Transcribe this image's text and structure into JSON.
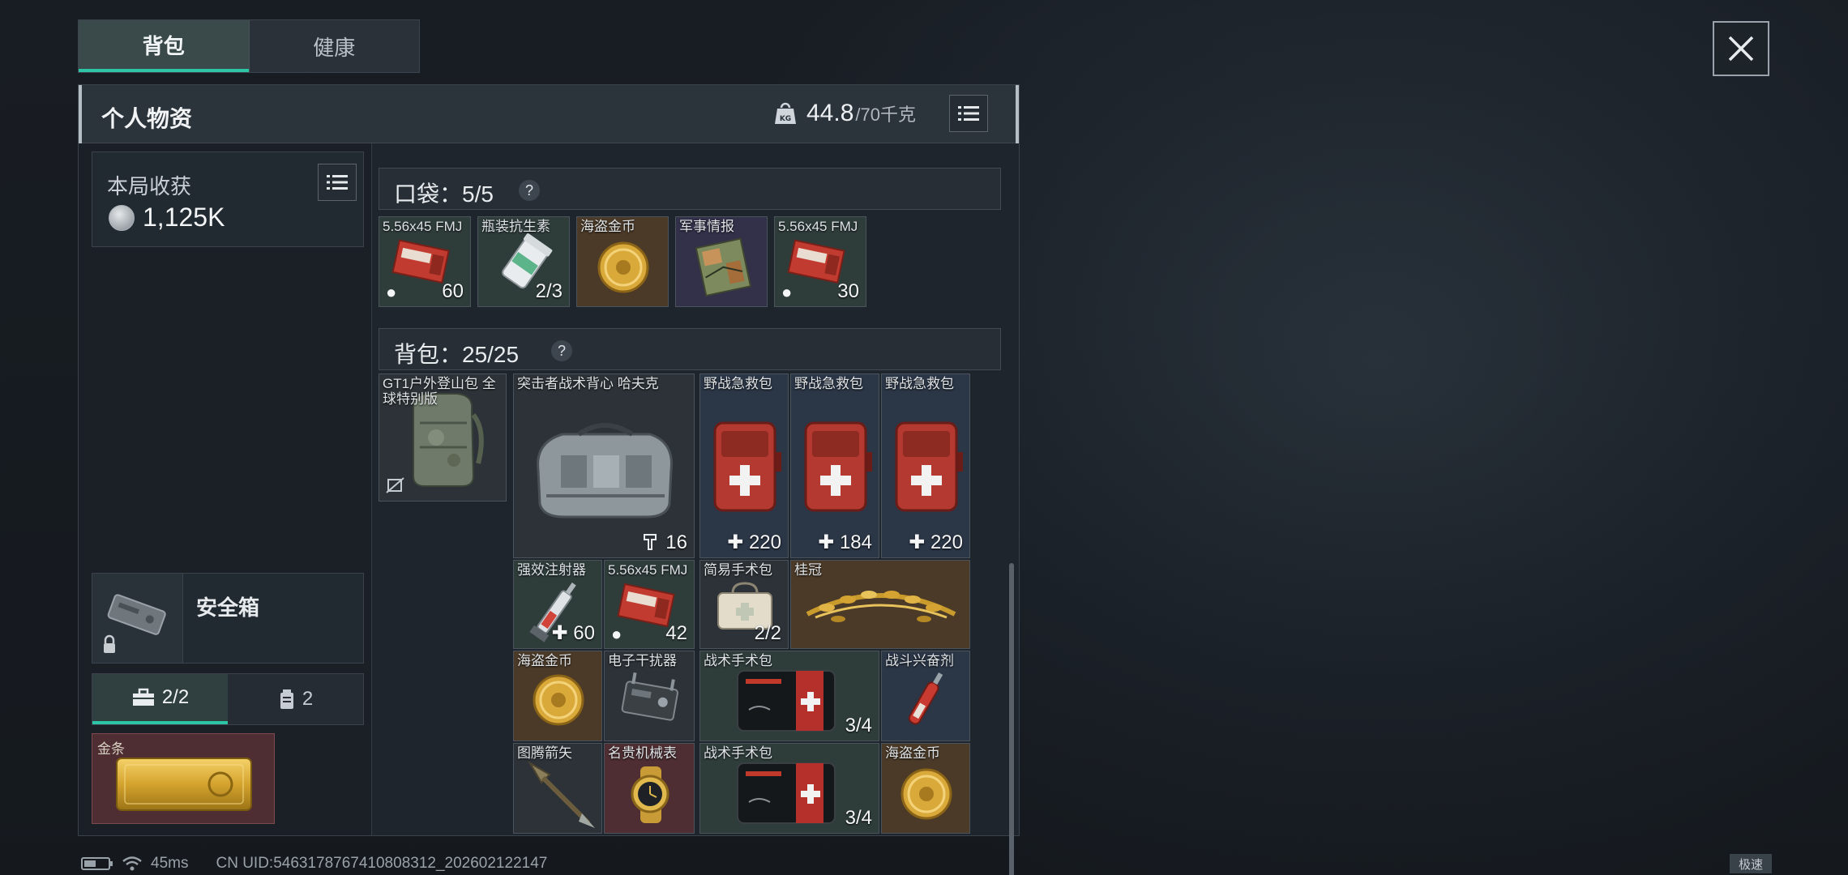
{
  "tabs": [
    {
      "label": "背包",
      "active": true
    },
    {
      "label": "健康",
      "active": false
    }
  ],
  "panel": {
    "title": "个人物资",
    "weight_current": "44.8",
    "weight_max": "/70千克"
  },
  "left": {
    "harvest_label": "本局收获",
    "harvest_value": "1,125K",
    "safe_box_label": "安全箱",
    "sub_tabs": [
      {
        "label": "2/2",
        "icon": "toolbox-icon",
        "active": true
      },
      {
        "label": "2",
        "icon": "canister-icon",
        "active": false
      }
    ],
    "gold_item": {
      "name": "金条"
    }
  },
  "pocket": {
    "label": "口袋：5/5",
    "items": [
      {
        "name": "5.56x45 FMJ",
        "count": "60",
        "color": "green",
        "icon": "ammo-box-icon"
      },
      {
        "name": "瓶装抗生素",
        "count": "2/3",
        "color": "green",
        "icon": "pill-bottle-icon"
      },
      {
        "name": "海盗金币",
        "count": "",
        "color": "gold",
        "icon": "gold-coin-icon"
      },
      {
        "name": "军事情报",
        "count": "",
        "color": "purple",
        "icon": "intel-map-icon"
      },
      {
        "name": "5.56x45 FMJ",
        "count": "30",
        "color": "green",
        "icon": "ammo-box-icon"
      }
    ]
  },
  "backpack": {
    "label": "背包：25/25",
    "items": [
      {
        "name": "GT1户外登山包 全球特别版",
        "count": "",
        "color": "gray",
        "icon": "backpack-icon"
      },
      {
        "name": "突击者战术背心 哈夫克",
        "count": "16",
        "color": "gray",
        "icon": "tactical-vest-icon"
      },
      {
        "name": "野战急救包",
        "count": "220",
        "color": "blue",
        "icon": "medkit-icon"
      },
      {
        "name": "野战急救包",
        "count": "184",
        "color": "blue",
        "icon": "medkit-icon"
      },
      {
        "name": "野战急救包",
        "count": "220",
        "color": "blue",
        "icon": "medkit-icon"
      },
      {
        "name": "强效注射器",
        "count": "60",
        "color": "green",
        "icon": "syringe-icon"
      },
      {
        "name": "5.56x45 FMJ",
        "count": "42",
        "color": "green",
        "icon": "ammo-box-icon"
      },
      {
        "name": "简易手术包",
        "count": "2/2",
        "color": "gray",
        "icon": "surgery-bag-icon"
      },
      {
        "name": "桂冠",
        "count": "",
        "color": "gold",
        "icon": "laurel-crown-icon"
      },
      {
        "name": "海盗金币",
        "count": "",
        "color": "gold",
        "icon": "gold-coin-icon"
      },
      {
        "name": "电子干扰器",
        "count": "",
        "color": "gray",
        "icon": "jammer-icon"
      },
      {
        "name": "战术手术包",
        "count": "3/4",
        "color": "green",
        "icon": "surgical-kit-icon"
      },
      {
        "name": "战斗兴奋剂",
        "count": "",
        "color": "blue",
        "icon": "stim-injector-icon"
      },
      {
        "name": "图腾箭矢",
        "count": "",
        "color": "gray",
        "icon": "totem-arrow-icon"
      },
      {
        "name": "名贵机械表",
        "count": "",
        "color": "red",
        "icon": "watch-icon"
      },
      {
        "name": "战术手术包",
        "count": "3/4",
        "color": "green",
        "icon": "surgical-kit-icon"
      },
      {
        "name": "海盗金币",
        "count": "",
        "color": "gold",
        "icon": "gold-coin-icon"
      }
    ]
  },
  "status": {
    "ping": "45ms",
    "uid": "CN UID:5463178767410808312_202602122147",
    "speed_badge": "极速"
  }
}
